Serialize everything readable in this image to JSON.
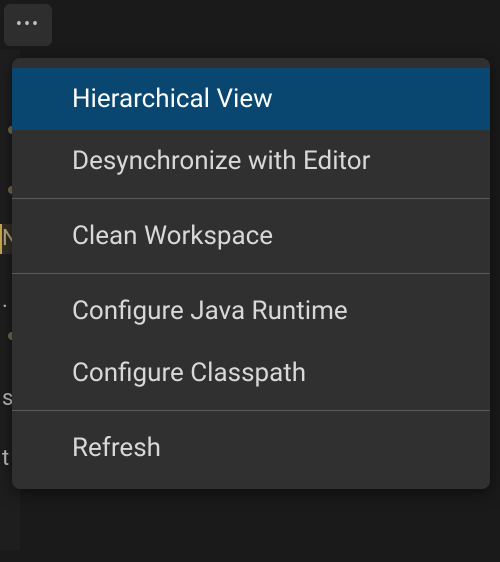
{
  "more_button": {
    "glyph": "•••"
  },
  "menu": {
    "items": [
      {
        "id": "hierarchical-view",
        "label": "Hierarchical View",
        "highlighted": true
      },
      {
        "id": "desynchronize",
        "label": "Desynchronize with Editor",
        "highlighted": false
      },
      {
        "sep": true
      },
      {
        "id": "clean-workspace",
        "label": "Clean Workspace",
        "highlighted": false
      },
      {
        "sep": true
      },
      {
        "id": "configure-runtime",
        "label": "Configure Java Runtime",
        "highlighted": false
      },
      {
        "id": "configure-classpath",
        "label": "Configure Classpath",
        "highlighted": false
      },
      {
        "sep": true
      },
      {
        "id": "refresh",
        "label": "Refresh",
        "highlighted": false
      }
    ]
  },
  "background": {
    "chars": [
      "",
      "",
      "N",
      ".",
      "",
      "s",
      "t"
    ]
  }
}
